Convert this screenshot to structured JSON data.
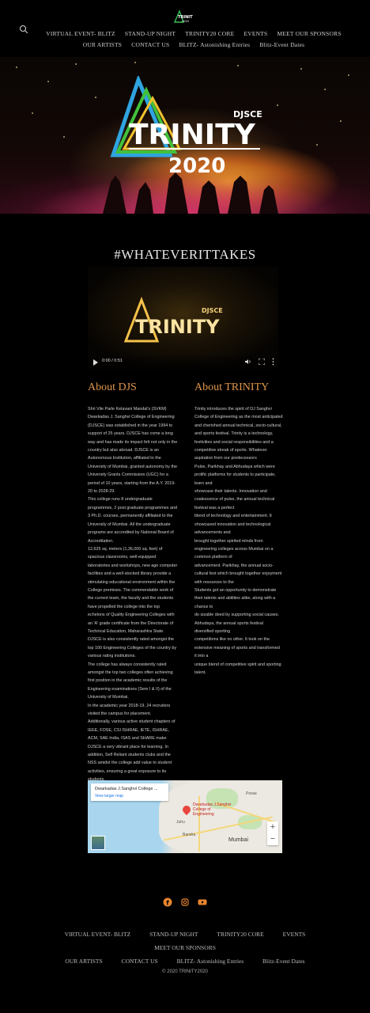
{
  "header": {
    "logo_text": "TRINITY 2020",
    "nav": [
      "VIRTUAL EVENT- BLITZ",
      "STAND-UP NIGHT",
      "TRINITY20 CORE",
      "EVENTS",
      "MEET OUR SPONSORS",
      "OUR ARTISTS",
      "CONTACT US",
      "BLITZ- Astonishing Entries",
      "Blitz-Event Dates"
    ]
  },
  "hero": {
    "org": "DJSCE",
    "title": "TRINITY",
    "year": "2020"
  },
  "tagline": "#WHATEVERITTAKES",
  "video": {
    "logo_org": "DJSCE",
    "logo_title": "TRINITY",
    "time": "0:00 / 0:51"
  },
  "about_djs": {
    "title": "About DJS",
    "paragraphs": [
      "Shri Vile Parle Kelavani Mandal's (SVKM) Dwarkadas J. Sanghvi College of Engineering (DJSCE) was established in the year 1994 to support of 25 years. DJSCE has come a long way and has made its impact felt not only in the country but also abroad. DJSCE is an Autonomous Institution, affiliated to the University of Mumbai, granted autonomy by the University Grants Commission (UGC) for a period of 10 years, starting from the A.Y. 2019-20 to 2028-29.",
      "This college runs 8 undergraduate programmes, 2 post graduate programmes and 3 Ph.D. courses, permanently affiliated to the University of Mumbai. All the undergraduate programs are accredited by National Board of Accreditation.",
      "12,625 sq. meters (1,36,000 sq. feet) of spacious classrooms, well-equipped laboratories and workshops, new age computer facilities and a well-stocked library provide a stimulating educational environment within the College premises. The commendable work of the current team, the faculty and the students have propelled the college into the top echelons of Quality Engineering Colleges with an 'A' grade certificate from the Directorate of Technical Education, Maharashtra State. DJSCE is also consistently rated amongst the top 100 Engineering Colleges of the country by various rating institutions.",
      "The college has always consistently rated amongst the top two colleges often achieving first position in the academic results of the Engineering examinations (Sem I & II) of the University of Mumbai.",
      "In the academic year 2018-19, 24 recruiters visited the campus for placement.",
      "Additionally, various active student chapters of IEEE, FOSE, CSI ISHRAE, IETE, ISHRAE, ACM, SAE India, ISAS and SHARE make DJSCE a very vibrant place for learning. In addition, Self Reliant students clubs and the NSS amidst the college add value to student activities, ensuring a great exposure to its students."
    ]
  },
  "about_trinity": {
    "title": "About TRINITY",
    "paragraphs": [
      "Trinity introduces the spirit of DJ Sanghvi College of Engineering as the most anticipated and cherished annual technical, socio-cultural, and sports festival. Trinity is a technology, festivities and social responsibilities and a competitive streak of sports. Whatever aspiration from our predecessors",
      "Pulse, Parikhay and Abhudaya which were prolific platforms for students to participate, learn and",
      "showcase their talents. Innovation and coalescence of pulse, the annual technical festival was a perfect",
      "blend of technology and entertainment. It showcased innovation and technological advancements and",
      "brought together spirited minds from engineering colleges across Mumbai on a common platform of",
      "advancement. Parikhay, the annual socio-cultural fest which brought together enjoyment with resources to the",
      "Students got an opportunity to demonstrate their talents and abilities alike, along with a chance to",
      "do sizable deed by supporting social causes. Abhudaya, the annual sports festival diversified sporting",
      "competitions like no other. It took on the extensive meaning of sports and transformed it into a",
      "unique blend of competitive spirit and sporting talent."
    ]
  },
  "map": {
    "place_name": "Dwarkadas J.Sanghvi College ...",
    "link": "View larger map",
    "pin_label": "Dwarkadas J.Sanghvi College of Engineering",
    "labels": [
      "Powai",
      "Mumbai",
      "Juhu",
      "Bandra"
    ]
  },
  "social": [
    "facebook-icon",
    "instagram-icon",
    "youtube-icon"
  ],
  "footer": {
    "nav": [
      "VIRTUAL EVENT- BLITZ",
      "STAND-UP NIGHT",
      "TRINITY20 CORE",
      "EVENTS",
      "MEET OUR SPONSORS",
      "OUR ARTISTS",
      "CONTACT US",
      "BLITZ- Astonishing Entries",
      "Blitz-Event Dates"
    ],
    "copyright": "© 2020 TRINITY2020"
  },
  "colors": {
    "accent": "#e0954a",
    "background": "#000000",
    "social": "#e8852e"
  }
}
